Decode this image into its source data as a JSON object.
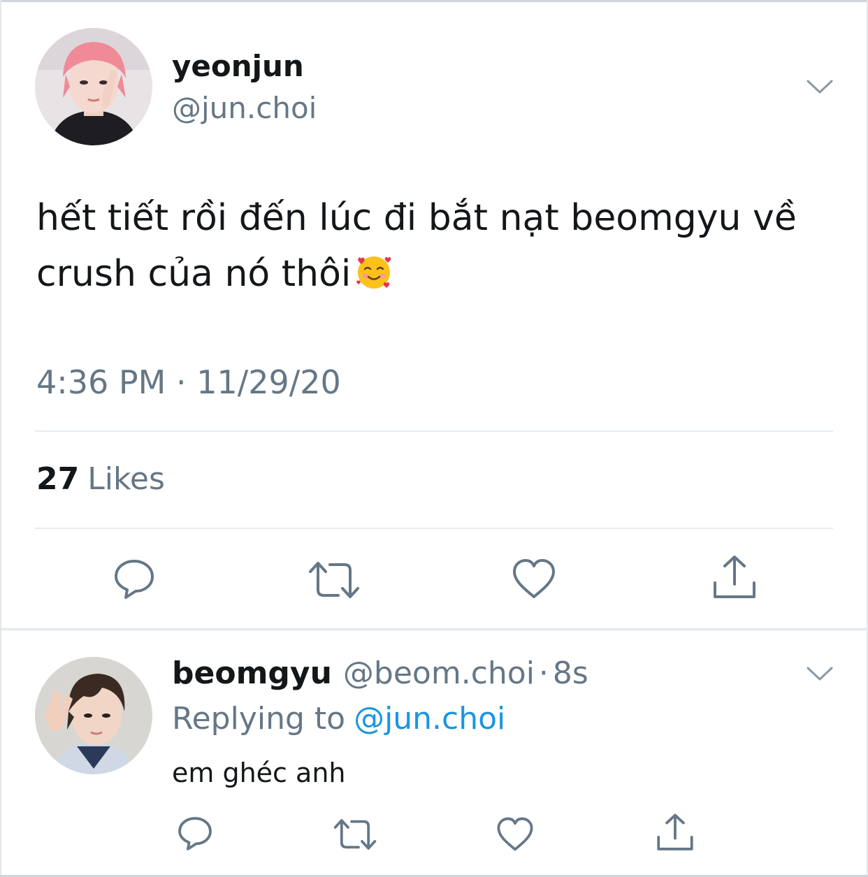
{
  "tweet": {
    "display_name": "yeonjun",
    "handle": "@jun.choi",
    "text": "hết tiết rồi đến lúc đi bắt nạt beomgyu về crush của nó thôi",
    "emoji_icon": "smiling-face-with-hearts-icon",
    "timestamp": "4:36 PM · 11/29/20",
    "likes_count": "27",
    "likes_label": "Likes"
  },
  "reply": {
    "display_name": "beomgyu",
    "handle": "@beom.choi",
    "separator": "·",
    "time": "8s",
    "replying_prefix": "Replying to",
    "replying_target": "@jun.choi",
    "text": "em ghéc anh"
  },
  "actions": [
    "reply-icon",
    "retweet-icon",
    "like-icon",
    "share-icon"
  ],
  "colors": {
    "text_primary": "#14171a",
    "text_secondary": "#657786",
    "link": "#1b95e0",
    "divider": "#e6ecf0",
    "icon": "#657786"
  }
}
